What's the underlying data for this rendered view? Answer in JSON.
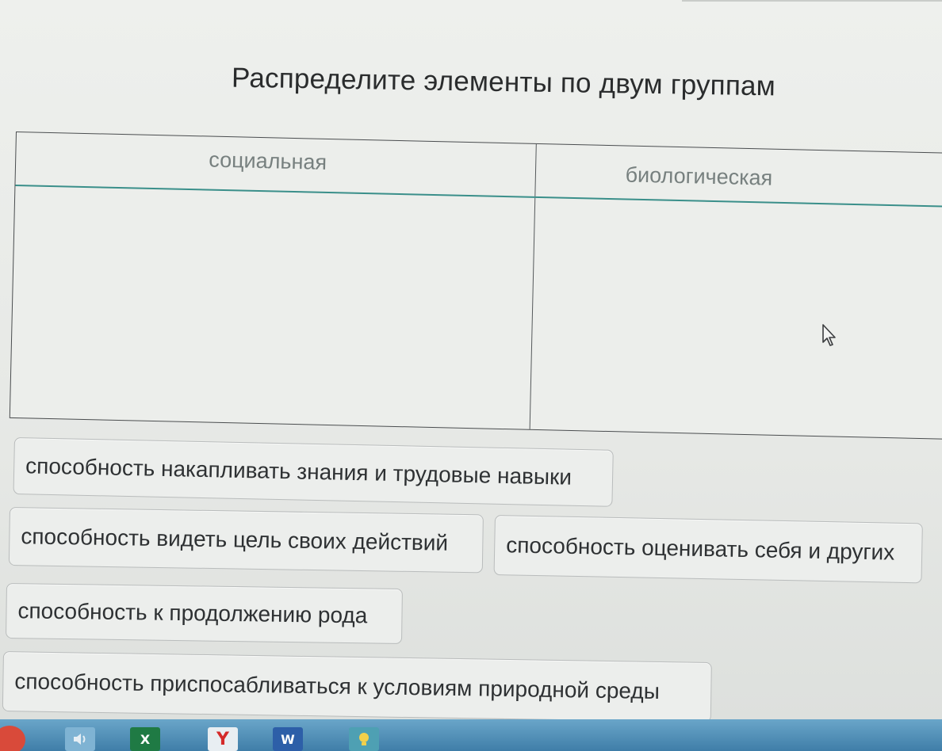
{
  "task": {
    "title": "Распределите элементы по двум группам"
  },
  "groups": [
    {
      "label": "социальная"
    },
    {
      "label": "биологическая"
    }
  ],
  "items": [
    {
      "label": "способность накапливать знания и трудовые навыки"
    },
    {
      "label": "способность видеть цель своих действий"
    },
    {
      "label": "способность оценивать себя и других"
    },
    {
      "label": "способность к продолжению рода"
    },
    {
      "label": "способность приспосабливаться к условиям природной среды"
    }
  ],
  "taskbar": {
    "icons": [
      {
        "name": "start-icon",
        "glyph": ""
      },
      {
        "name": "sound-icon",
        "glyph": ""
      },
      {
        "name": "excel-icon",
        "glyph": "X"
      },
      {
        "name": "yandex-browser-icon",
        "glyph": "Y"
      },
      {
        "name": "word-icon",
        "glyph": "W"
      },
      {
        "name": "app-icon",
        "glyph": ""
      }
    ]
  },
  "colors": {
    "accent_teal": "#3a8f8a",
    "header_text": "#77807f",
    "taskbar": "#3f7ea8"
  }
}
